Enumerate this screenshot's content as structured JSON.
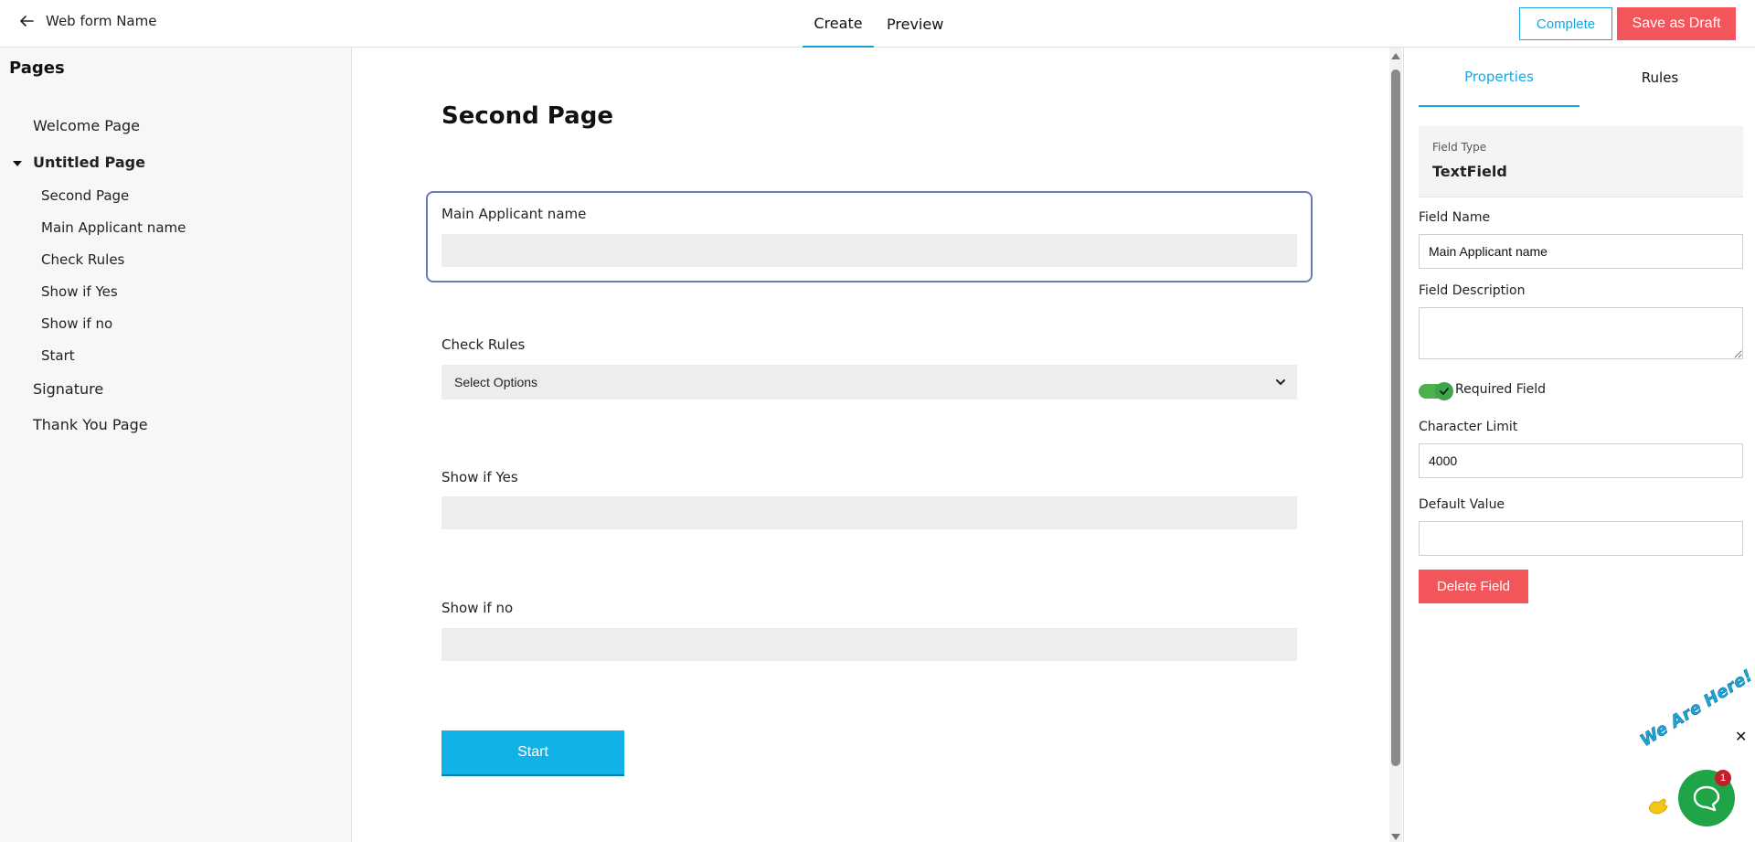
{
  "header": {
    "back_label": "Web form Name",
    "tabs": [
      {
        "label": "Create",
        "active": true
      },
      {
        "label": "Preview",
        "active": false
      }
    ],
    "complete_label": "Complete",
    "draft_label": "Save as Draft"
  },
  "sidebar": {
    "title": "Pages",
    "items": [
      {
        "label": "Welcome Page"
      },
      {
        "label": "Untitled Page"
      },
      {
        "label": "Signature"
      },
      {
        "label": "Thank You Page"
      }
    ],
    "sub_items": [
      {
        "label": "Second Page"
      },
      {
        "label": "Main Applicant name"
      },
      {
        "label": "Check Rules"
      },
      {
        "label": "Show if Yes"
      },
      {
        "label": "Show if no"
      },
      {
        "label": "Start"
      }
    ]
  },
  "main": {
    "page_title": "Second Page",
    "fields": [
      {
        "label": "Main Applicant name"
      },
      {
        "label": "Check Rules",
        "placeholder": "Select Options"
      },
      {
        "label": "Show if Yes"
      },
      {
        "label": "Show if no"
      }
    ],
    "start_label": "Start"
  },
  "properties": {
    "tabs": [
      {
        "label": "Properties",
        "active": true
      },
      {
        "label": "Rules",
        "active": false
      }
    ],
    "field_type_label": "Field Type",
    "field_type_value": "TextField",
    "field_name_label": "Field Name",
    "field_name_value": "Main Applicant name",
    "field_description_label": "Field Description",
    "required_label": "Required Field",
    "required_on": true,
    "char_limit_label": "Character Limit",
    "char_limit_value": "4000",
    "default_value_label": "Default Value",
    "default_value": "",
    "delete_label": "Delete Field"
  },
  "chat": {
    "text": "We Are Here!",
    "badge": "1",
    "close": "✕"
  },
  "colors": {
    "accent": "#1aa7df",
    "danger": "#f2565a",
    "start_button": "#12b1e6",
    "chat_green": "#1fa447"
  }
}
